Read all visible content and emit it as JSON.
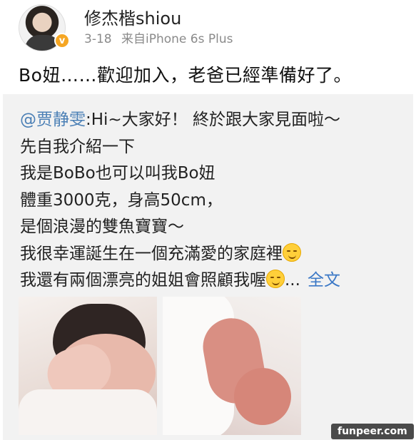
{
  "user": {
    "name": "修杰楷shiou",
    "date": "3-18",
    "source": "来自iPhone 6s Plus"
  },
  "post": {
    "text": "Bo妞……歡迎加入，老爸已經準備好了。"
  },
  "repost": {
    "mention": "@贾静雯",
    "line1": ":Hi~大家好！ 終於跟大家見面啦～",
    "line2": "先自我介紹一下",
    "line3": "我是BoBo也可以叫我Bo妞",
    "line4": "體重3000克，身高50cm，",
    "line5": "是個浪漫的雙魚寶寶～",
    "line6": "我很幸運誕生在一個充滿愛的家庭裡",
    "line7": "我還有兩個漂亮的姐姐會照顧我喔",
    "ellipsis": "...",
    "more_label": "全文"
  },
  "watermark": "funpeer.com"
}
